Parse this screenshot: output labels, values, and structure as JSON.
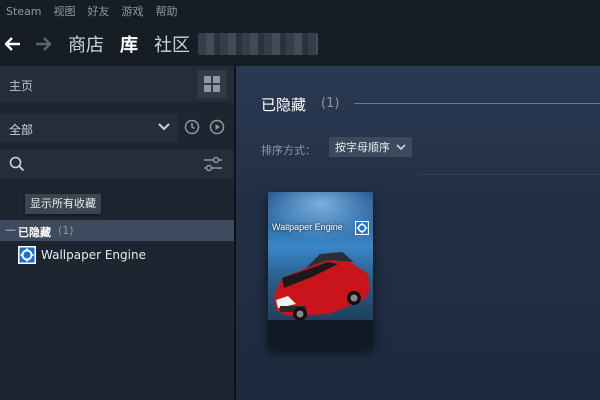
{
  "menubar": {
    "items": [
      "Steam",
      "视图",
      "好友",
      "游戏",
      "帮助"
    ]
  },
  "nav": {
    "back_icon": "arrow-left-icon",
    "forward_icon": "arrow-right-icon",
    "tabs": [
      {
        "label": "商店",
        "active": false
      },
      {
        "label": "库",
        "active": true
      },
      {
        "label": "社区",
        "active": false
      }
    ]
  },
  "sidebar": {
    "home_label": "主页",
    "filter_value": "全部",
    "search_placeholder": "",
    "tooltip": "显示所有收藏",
    "category": {
      "label": "已隐藏",
      "count": "(1)"
    },
    "games": [
      {
        "name": "Wallpaper Engine",
        "icon": "wallpaper-engine-icon"
      }
    ]
  },
  "main": {
    "section_title": "已隐藏",
    "section_count": "(1)",
    "sort_label": "排序方式：",
    "sort_value": "按字母顺序",
    "card": {
      "title": "Wallpaper Engine"
    }
  },
  "colors": {
    "background": "#1b2838",
    "sidebar": "#1e2530",
    "selected_category": "#3e4b5e",
    "accent_blue": "#1a9fff"
  }
}
